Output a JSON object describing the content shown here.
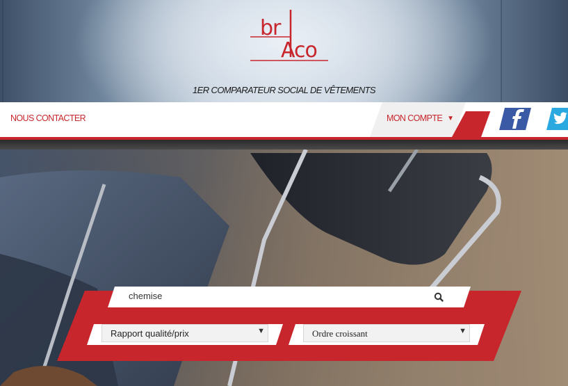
{
  "header": {
    "logo": {
      "text_top": "br",
      "text_bottom": "Aco",
      "color": "#c7262c"
    },
    "tagline": "1ER COMPARATEUR SOCIAL DE VÊTEMENTS"
  },
  "nav": {
    "contact_label": "NOUS CONTACTER",
    "account_label": "MON COMPTE",
    "account_icon": "caret-down-icon",
    "social": [
      {
        "name": "facebook",
        "icon": "facebook-icon",
        "color": "#3b5aa6"
      },
      {
        "name": "twitter",
        "icon": "twitter-icon",
        "color": "#2aa9e0"
      }
    ]
  },
  "search": {
    "query": "chemise",
    "button_icon": "search-icon",
    "sort_criteria": {
      "selected": "Rapport qualité/prix"
    },
    "sort_order": {
      "selected": "Ordre croissant"
    }
  },
  "colors": {
    "accent": "#c7262c",
    "nav_bg": "#ffffff",
    "dark_band": "#333333"
  }
}
